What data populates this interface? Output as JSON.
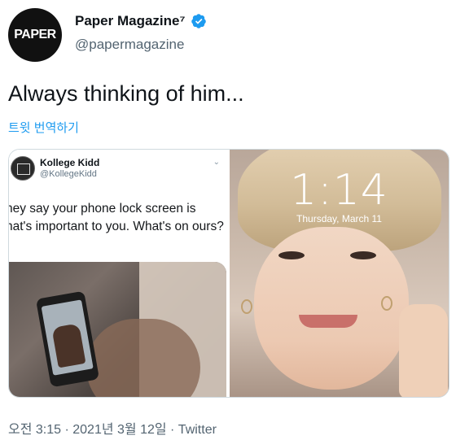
{
  "account": {
    "avatar_text": "PAPER",
    "display_name": "Paper Magazine⁷",
    "handle": "@papermagazine",
    "verified_icon": "verified-badge-icon"
  },
  "tweet": {
    "text": "Always thinking of him...",
    "translate_link": "트윗 번역하기"
  },
  "quoted_tweet": {
    "name": "Kollege Kidd",
    "handle": "@KollegeKidd",
    "text": "ney say your phone lock screen is hat's important to you. What's on ours?"
  },
  "lock_screen": {
    "time": "1:14",
    "date": "Thursday, March 11"
  },
  "footer": {
    "timestamp": "오전 3:15 · 2021년 3월 12일 · Twitter"
  },
  "colors": {
    "link": "#1d9bf0",
    "verified": "#1d9bf0",
    "secondary_text": "#536471"
  }
}
